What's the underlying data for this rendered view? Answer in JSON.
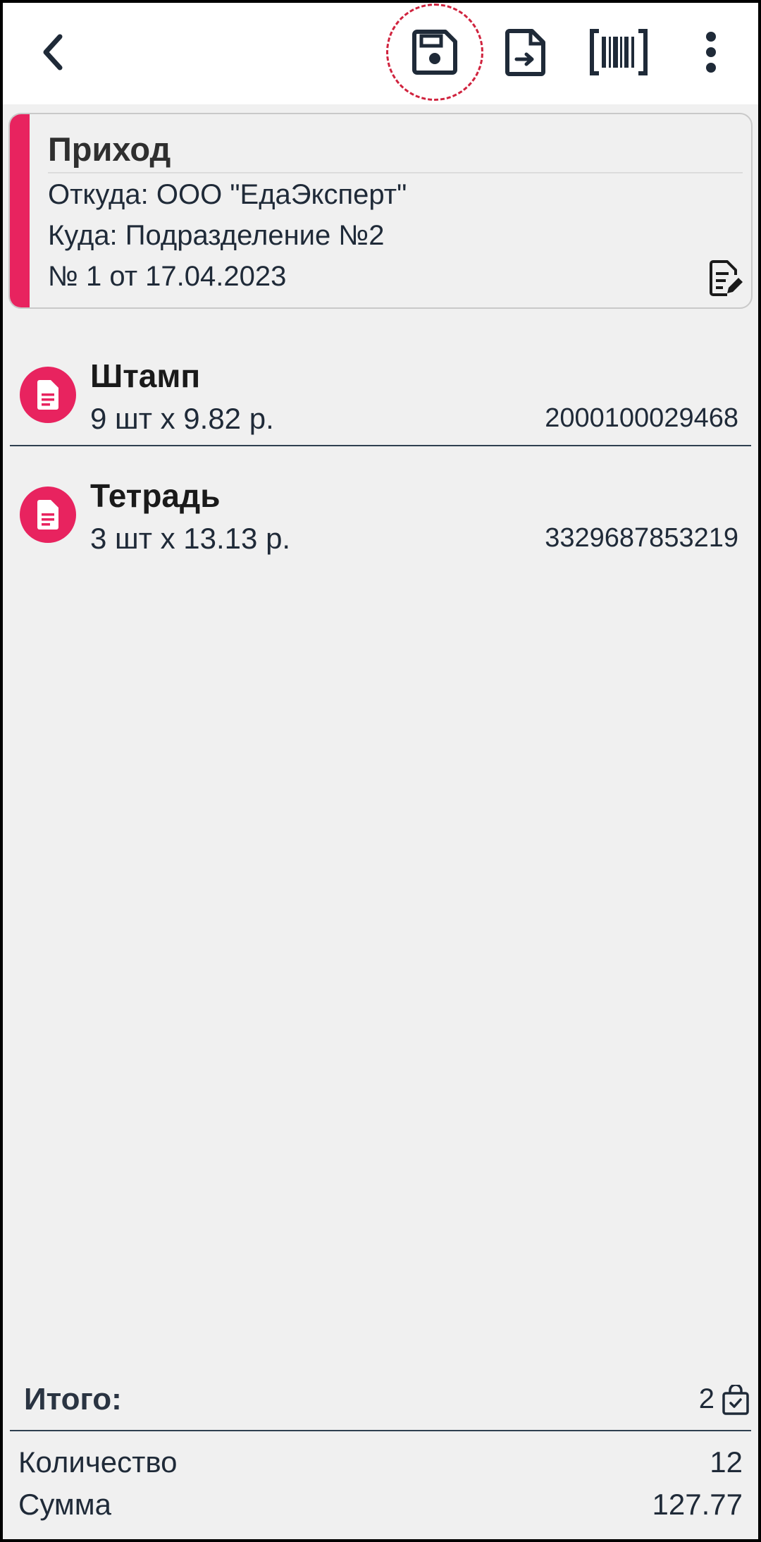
{
  "toolbar": {
    "back_icon": "chevron-left-icon",
    "save_icon": "floppy-disk-icon",
    "export_icon": "file-export-icon",
    "barcode_icon": "barcode-scan-icon",
    "more_icon": "more-vertical-icon",
    "highlight_color": "#d0233e"
  },
  "document": {
    "title": "Приход",
    "from": "Откуда: ООО \"ЕдаЭксперт\"",
    "to": "Куда: Подразделение №2",
    "number": "№ 1 от 17.04.2023",
    "accent_color": "#e8235f",
    "edit_icon": "document-edit-icon"
  },
  "items": [
    {
      "name": "Штамп",
      "qty_price": "9 шт x 9.82 р.",
      "barcode": "2000100029468",
      "icon": "document-icon"
    },
    {
      "name": "Тетрадь",
      "qty_price": "3 шт x 13.13 р.",
      "barcode": "3329687853219",
      "icon": "document-icon"
    }
  ],
  "totals": {
    "title": "Итого:",
    "positions_count": "2",
    "positions_icon": "shopping-bag-icon",
    "quantity_label": "Количество",
    "quantity_value": "12",
    "sum_label": "Сумма",
    "sum_value": "127.77"
  }
}
